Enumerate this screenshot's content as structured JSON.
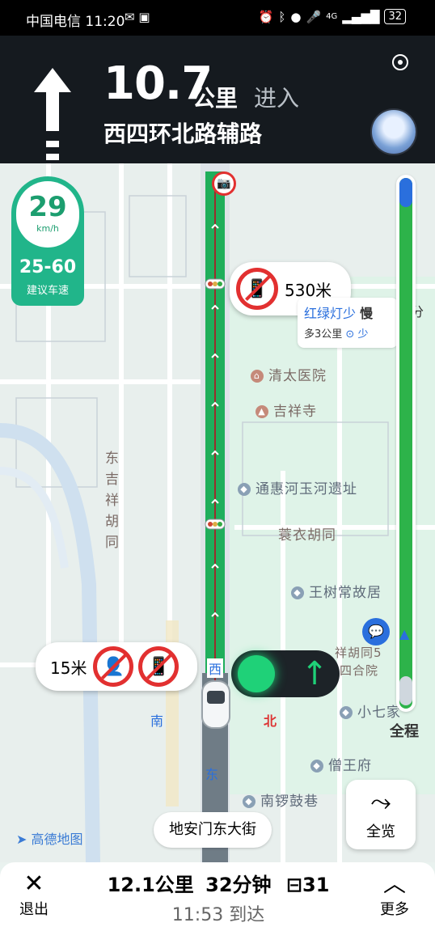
{
  "status_bar": {
    "carrier": "中国电信",
    "time": "11:20",
    "battery": "32",
    "network": "4G"
  },
  "guidance": {
    "distance": "10.7",
    "unit": "公里",
    "action": "进入",
    "road": "西四环北路辅路"
  },
  "speed": {
    "current": "29",
    "unit": "km/h",
    "recommended_range": "25-60",
    "recommended_label": "建议车速"
  },
  "alerts": {
    "phone_ban_distance": "530米",
    "near_alert_distance": "15米"
  },
  "route_info_card": {
    "line1_a": "红绿灯少",
    "line1_b": "慢",
    "line1_c": "分",
    "line2": "多3公里"
  },
  "map_labels": {
    "poi_qingtai": "清太医院",
    "poi_jixiang": "吉祥寺",
    "poi_tonghuihe": "通惠河玉河遗址",
    "hutong_east": "东吉祥胡同",
    "hutong_north": "蓑衣胡同",
    "poi_wangshuchang": "王树常故居",
    "poi_jixiang5": "祥胡同5",
    "poi_sihe": "四合院",
    "poi_xiaoqi": "小七家",
    "poi_sengwang": "僧王府",
    "poi_nanluogu": "南锣鼓巷",
    "dir_west": "西",
    "dir_south": "南",
    "dir_north": "北",
    "dir_east": "东",
    "amap_logo": "高德地图",
    "street_name": "地安门东大街"
  },
  "buttons": {
    "overview": "全览",
    "full_route": "全程",
    "exit": "退出",
    "more": "更多"
  },
  "trip": {
    "remaining_distance": "12.1公里",
    "remaining_time": "32分钟",
    "traffic_lights": "31",
    "arrival": "11:53 到达"
  },
  "colors": {
    "route_green": "#1fae5c",
    "accent_teal": "#21b58a",
    "header_bg": "#151a1f",
    "alert_red": "#e23030"
  }
}
